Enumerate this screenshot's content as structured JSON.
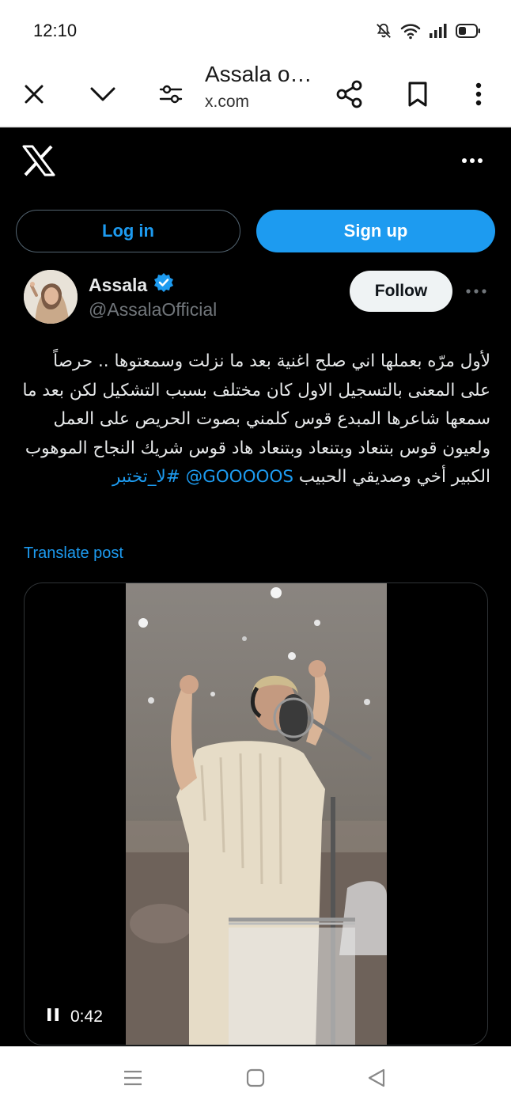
{
  "status_bar": {
    "time": "12:10"
  },
  "browser": {
    "tab_title": "Assala o…",
    "domain": "x.com"
  },
  "header": {
    "login_label": "Log in",
    "signup_label": "Sign up"
  },
  "tweet": {
    "author_name": "Assala",
    "author_handle": "@AssalaOfficial",
    "follow_label": "Follow",
    "text_body": "لأول مرّه بعملها اني صلح اغنية بعد ما نزلت وسمعتوها .. حرصاً على المعنى بالتسجيل  الاول كان مختلف بسبب التشكيل لكن بعد ما سمعها شاعرها المبدع قوس كلمني بصوت الحريص على العمل ولعيون قوس بتنعاد وبتنعاد وبتنعاد هاد قوس شريك النجاح الموهوب الكبير أخي وصديقي الحبيب",
    "mention": "@GOOOOOS",
    "hashtag": "#لا_تختبر",
    "translate_label": "Translate post"
  },
  "video": {
    "time": "0:42"
  },
  "colors": {
    "accent": "#1d9bf0",
    "background": "#000000",
    "text": "#e7e9ea",
    "muted": "#71767b"
  }
}
